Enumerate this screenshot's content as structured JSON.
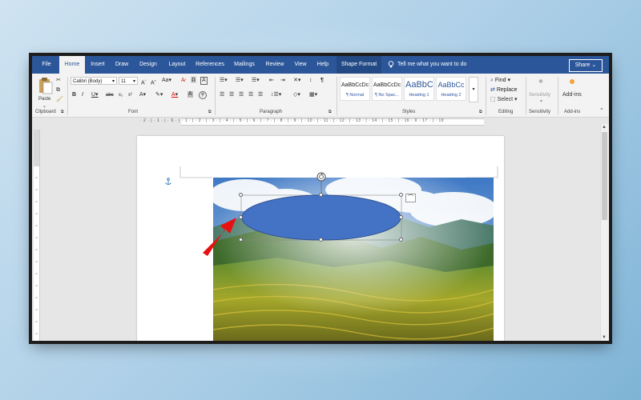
{
  "ribbon_tabs": [
    "File",
    "Home",
    "Insert",
    "Draw",
    "Design",
    "Layout",
    "References",
    "Mailings",
    "Review",
    "View",
    "Help",
    "Shape Format"
  ],
  "tell_me": "Tell me what you want to do",
  "share_label": "Share",
  "clipboard": {
    "paste_label": "Paste",
    "group_label": "Clipboard"
  },
  "font": {
    "name": "Calibri (Body)",
    "size": "11",
    "group_label": "Font"
  },
  "paragraph": {
    "group_label": "Paragraph"
  },
  "styles": {
    "group_label": "Styles",
    "items": [
      {
        "sample": "AaBbCcDc",
        "name": "¶ Normal"
      },
      {
        "sample": "AaBbCcDc",
        "name": "¶ No Spac..."
      },
      {
        "sample": "AaBbC",
        "name": "Heading 1"
      },
      {
        "sample": "AaBbCc",
        "name": "Heading 2"
      }
    ]
  },
  "editing": {
    "find": "Find",
    "replace": "Replace",
    "select": "Select",
    "group_label": "Editing"
  },
  "sensitivity": {
    "label": "Sensitivity",
    "group_label": "Sensitivity"
  },
  "addins": {
    "label": "Add-ins",
    "group_label": "Add-ins"
  },
  "colors": {
    "ribbon_blue": "#2b579a",
    "shape_fill": "#4472c4",
    "arrow_red": "#e81010"
  }
}
